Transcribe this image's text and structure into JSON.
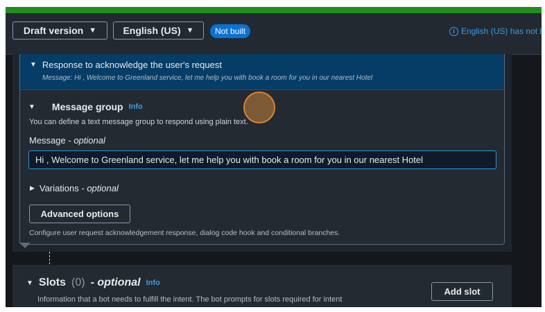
{
  "topbar": {
    "version_label": "Draft version",
    "language_label": "English (US)",
    "build_badge": "Not built",
    "notice_text": "English (US) has not bui"
  },
  "response": {
    "title": "Response to acknowledge the user's request",
    "message_preview": "Message: Hi , Welcome to Greenland service, let me help you with book a room for you in our nearest Hotel"
  },
  "message_group": {
    "title": "Message group",
    "info": "Info",
    "description": "You can define a text message group to respond using plain text.",
    "message_label": "Message",
    "message_optional": "optional",
    "message_value": "Hi , Welcome to Greenland service, let me help you with book a room for you in our nearest Hotel",
    "variations_label": "Variations",
    "variations_optional": "optional",
    "advanced_button": "Advanced options",
    "advanced_description": "Configure user request acknowledgement response, dialog code hook and conditional branches."
  },
  "slots": {
    "title": "Slots",
    "count": "(0)",
    "optional": "- optional",
    "info": "Info",
    "description": "Information that a bot needs to fulfill the intent. The bot prompts for slots required for intent",
    "add_button": "Add slot"
  },
  "icons": {
    "caret": "▼",
    "collapse": "▼",
    "expand": "▶",
    "info_glyph": "i"
  },
  "colors": {
    "accent": "#0972d3",
    "link": "#3d9ce6",
    "green_bar": "#1f8f1f",
    "header_blue": "#053d66",
    "focus_border": "#2b96d6"
  }
}
